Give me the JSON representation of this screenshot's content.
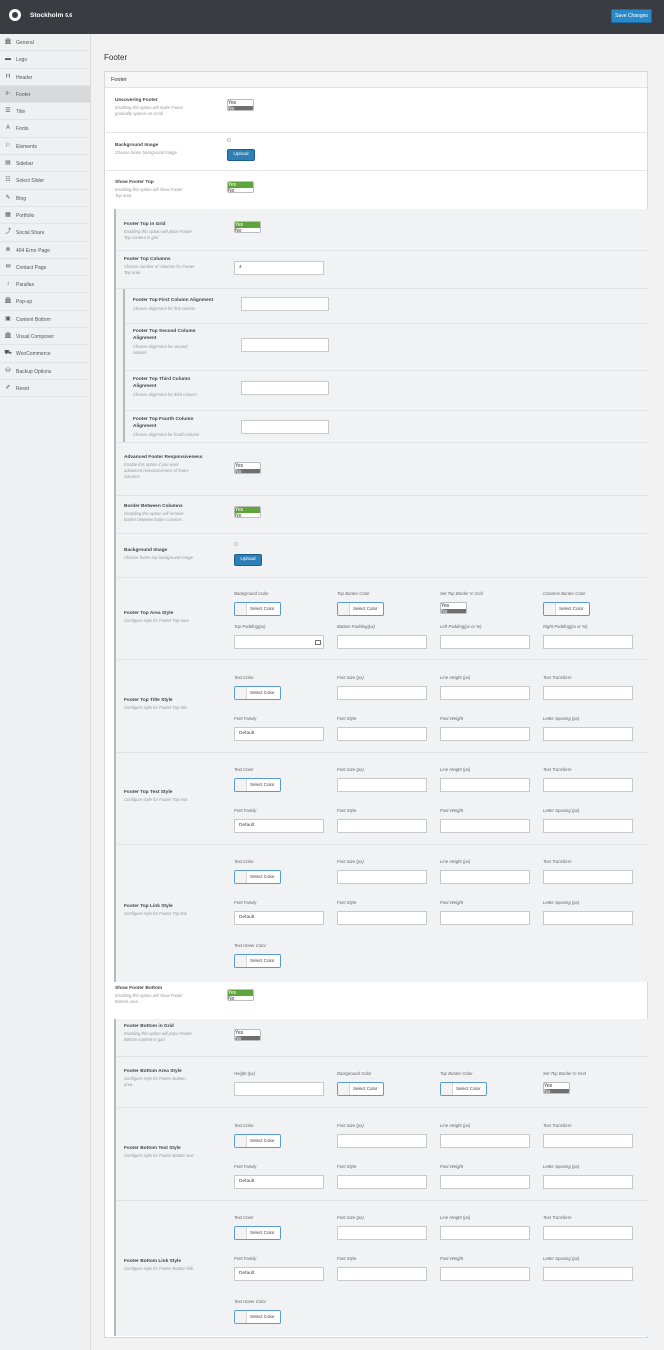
{
  "brand": {
    "name": "Stockholm",
    "version": "6.6"
  },
  "save_label": "Save Changes",
  "sidebar": [
    {
      "label": "General",
      "icon": "bank-icon",
      "glyph": "🏛"
    },
    {
      "label": "Logo",
      "icon": "image-icon",
      "glyph": "▬"
    },
    {
      "label": "Header",
      "icon": "header-icon",
      "glyph": "H"
    },
    {
      "label": "Footer",
      "icon": "footer-icon",
      "glyph": "⊩"
    },
    {
      "label": "Title",
      "icon": "list-icon",
      "glyph": "☰"
    },
    {
      "label": "Fonts",
      "icon": "font-icon",
      "glyph": "A"
    },
    {
      "label": "Elements",
      "icon": "flag-icon",
      "glyph": "⚐"
    },
    {
      "label": "Sidebar",
      "icon": "sidebar-icon",
      "glyph": "▤"
    },
    {
      "label": "Select Slider",
      "icon": "slider-icon",
      "glyph": "☷"
    },
    {
      "label": "Blog",
      "icon": "blog-icon",
      "glyph": "✎"
    },
    {
      "label": "Portfolio",
      "icon": "portfolio-icon",
      "glyph": "▦"
    },
    {
      "label": "Social Share",
      "icon": "share-icon",
      "glyph": "⤴"
    },
    {
      "label": "404 Error Page",
      "icon": "error-icon",
      "glyph": "⊗"
    },
    {
      "label": "Contact Page",
      "icon": "contact-icon",
      "glyph": "✉"
    },
    {
      "label": "Parallax",
      "icon": "parallax-icon",
      "glyph": "↕"
    },
    {
      "label": "Pop-up",
      "icon": "popup-icon",
      "glyph": "🏛"
    },
    {
      "label": "Content Bottom",
      "icon": "content-bottom-icon",
      "glyph": "▣"
    },
    {
      "label": "Visual Composer",
      "icon": "composer-icon",
      "glyph": "🏛"
    },
    {
      "label": "WooCommerce",
      "icon": "cart-icon",
      "glyph": "⛟"
    },
    {
      "label": "Backup Options",
      "icon": "backup-icon",
      "glyph": "⛁"
    },
    {
      "label": "Reset",
      "icon": "reset-icon",
      "glyph": "✐"
    }
  ],
  "page_title": "Footer",
  "panel_title": "Footer",
  "f": {
    "uncovering": {
      "title": "Uncovering Footer",
      "desc": [
        "Enabling this option will make Footer",
        "gradually appear on scroll"
      ]
    },
    "bg_image": {
      "title": "Background Image",
      "desc": [
        "Choose footer background image"
      ]
    },
    "show_top": {
      "title": "Show Footer Top",
      "desc": [
        "Enabling this option will show Footer",
        "Top area"
      ]
    },
    "top_grid": {
      "title": "Footer Top in Grid",
      "desc": [
        "Enabling this option will place Footer",
        "Top content in grid"
      ]
    },
    "top_columns": {
      "title": "Footer Top Columns",
      "desc": [
        "Choose number of columns for Footer",
        "Top area"
      ],
      "value": "4"
    },
    "col1": {
      "title": [
        "Footer Top First Column Alignment"
      ],
      "desc": [
        "Choose alignment for first column"
      ]
    },
    "col2": {
      "title": [
        "Footer Top Second Column",
        "Alignment"
      ],
      "desc": [
        "Choose alignment for second",
        "column"
      ]
    },
    "col3": {
      "title": [
        "Footer Top Third Column",
        "Alignment"
      ],
      "desc": [
        "Choose alignment for third column"
      ]
    },
    "col4": {
      "title": [
        "Footer Top Fourth Column",
        "Alignment"
      ],
      "desc": [
        "Choose alignment for fourth column"
      ]
    },
    "adv_resp": {
      "title": "Advanced Footer Responsiveness",
      "desc": [
        "Enable this option if you want",
        "advanced responsiveness of footer",
        "columns"
      ]
    },
    "border_cols": {
      "title": "Border Between Columns",
      "desc": [
        "Disabling this option will remove",
        "border between footer columns."
      ]
    },
    "top_bg_image": {
      "title": "Background Image",
      "desc": [
        "Choose footer top background image"
      ]
    },
    "top_area_style": {
      "title": "Footer Top Area Style",
      "desc": [
        "Configure style for Footer Top area"
      ]
    },
    "top_title_style": {
      "title": "Footer Top Title Style",
      "desc": [
        "Configure style for Footer Top title"
      ]
    },
    "top_text_style": {
      "title": "Footer Top Text Style",
      "desc": [
        "Configure style for Footer Top text"
      ]
    },
    "top_link_style": {
      "title": "Footer Top Link Style",
      "desc": [
        "Configure style for Footer Top link"
      ]
    },
    "show_bottom": {
      "title": "Show Footer Bottom",
      "desc": [
        "Enabling this option will show Footer",
        "Bottom area"
      ]
    },
    "bottom_grid": {
      "title": "Footer Bottom in Grid",
      "desc": [
        "Enabling this option will place Footer",
        "Bottom content in grid"
      ]
    },
    "bottom_area_style": {
      "title": "Footer Bottom Area Style",
      "desc": [
        "Configure style for Footer Bottom",
        "area"
      ]
    },
    "bottom_text_style": {
      "title": "Footer Bottom Text Style",
      "desc": [
        "Configure style for Footer Bottom text"
      ]
    },
    "bottom_link_style": {
      "title": "Footer Bottom Link Style",
      "desc": [
        "Configure style for Footer Bottom link"
      ]
    }
  },
  "labels": {
    "yes": "Yes",
    "no": "No",
    "upload": "Upload",
    "select_color": "Select Color",
    "default_font": "Default",
    "background_color": "Background Color",
    "top_border_color": "Top Border Color",
    "set_top_border_grid": "Set Top Border In Grid",
    "columns_border_color": "Columns Border Color",
    "top_padding": "Top Padding(px)",
    "bottom_padding": "Bottom Padding(px)",
    "left_padding": "Left Padding(px or %)",
    "right_padding": "Right Padding(px or %)",
    "text_color": "Text Color",
    "font_size": "Font Size (px)",
    "line_height": "Line Height (px)",
    "text_transform": "Text Transform",
    "font_family": "Font Family",
    "font_style": "Font Style",
    "font_weight": "Font Weight",
    "letter_spacing": "Letter Spacing (px)",
    "text_hover_color": "Text Hover Color",
    "height": "Height (px)"
  },
  "toggles": {
    "uncovering": false,
    "show_top": true,
    "top_grid": true,
    "adv_resp": false,
    "border_cols": true,
    "top_border_grid": false,
    "show_bottom": true,
    "bottom_grid": false,
    "bottom_border_grid": false
  },
  "colors": {
    "accent": "#2a89c8",
    "toggle_on": "#5ea43a",
    "toggle_off": "#6f6f6f",
    "topbar": "#393d42"
  }
}
